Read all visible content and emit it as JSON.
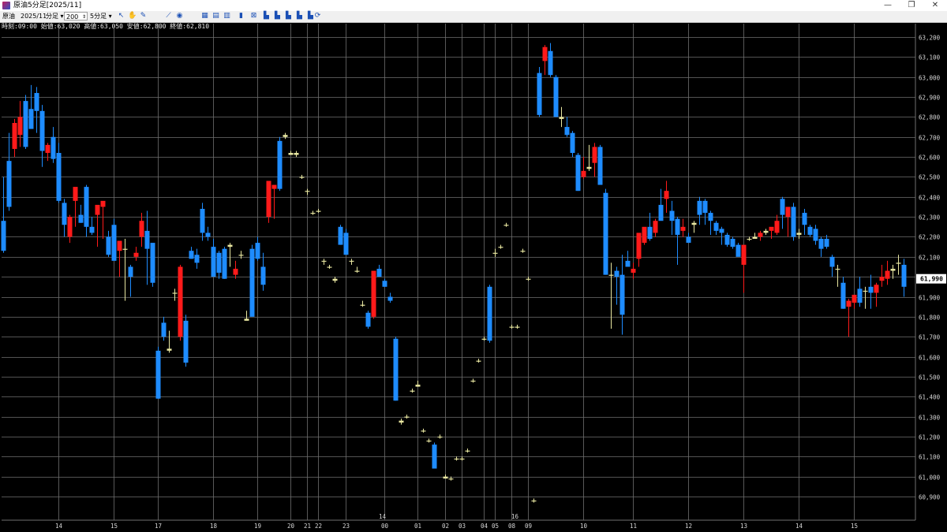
{
  "window": {
    "title": "原油5分足[2025/11]"
  },
  "window_controls": {
    "minimize": "—",
    "restore": "❐",
    "close": "✕"
  },
  "toolbar": {
    "symbol": "原油",
    "contract": "2025/11",
    "period_type": "分足",
    "bar_count": "200",
    "interval": "5分足",
    "icons": [
      "cursor-icon",
      "hand-icon",
      "pencil-icon",
      "line-icon",
      "circle-icon",
      "grid-icon",
      "table-icon",
      "table2-icon",
      "bar-chart-icon",
      "indicator-icon",
      "chart1-icon",
      "chart2-icon",
      "chart3-icon",
      "chart4-icon",
      "chart5-icon",
      "refresh-icon"
    ]
  },
  "quote_line": "時刻:09:00 始値:63,020 高値:63,050 安値:62,800 終値:62,810",
  "colors": {
    "up": "#ff1a1a",
    "down": "#1e8cff",
    "doji": "#e8e6a0",
    "grid": "#6f6f6f",
    "axis_text": "#d8d8d8"
  },
  "chart_data": {
    "type": "candlestick",
    "ylim": [
      60850,
      63250
    ],
    "y_ticks": [
      "63,200",
      "63,100",
      "63,000",
      "62,900",
      "62,800",
      "62,700",
      "62,600",
      "62,500",
      "62,400",
      "62,300",
      "62,200",
      "62,100",
      "62,000",
      "61,900",
      "61,800",
      "61,700",
      "61,600",
      "61,500",
      "61,400",
      "61,300",
      "61,200",
      "61,100",
      "61,000",
      "60,900"
    ],
    "y_tick_values": [
      63200,
      63100,
      63000,
      62900,
      62800,
      62700,
      62600,
      62500,
      62400,
      62300,
      62200,
      62100,
      62000,
      61900,
      61800,
      61700,
      61600,
      61500,
      61400,
      61300,
      61200,
      61100,
      61000,
      60900
    ],
    "last_price": "61,990",
    "last_price_value": 61990,
    "x_labels": [
      "14",
      "15",
      "17",
      "18",
      "19",
      "20",
      "21",
      "22",
      "23",
      "00",
      "01",
      "02",
      "03",
      "04",
      "05",
      "08",
      "09",
      "10",
      "11",
      "12",
      "13",
      "14",
      "15"
    ],
    "x_label_bar_index": [
      10,
      20,
      28,
      38,
      46,
      52,
      55,
      57,
      62,
      69,
      75,
      80,
      83,
      87,
      89,
      92,
      95,
      105,
      114,
      124,
      134,
      144,
      154
    ],
    "date_labels": [
      "14",
      "16"
    ],
    "date_label_bar_index": [
      68,
      92
    ],
    "bar_x_start": 4,
    "bar_spacing": 7,
    "ohlc": [
      [
        62280,
        62500,
        62120,
        62130
      ],
      [
        62580,
        62720,
        62330,
        62350
      ],
      [
        62640,
        62790,
        62600,
        62770
      ],
      [
        62710,
        62880,
        62650,
        62800
      ],
      [
        62880,
        62910,
        62640,
        62650
      ],
      [
        62840,
        62960,
        62770,
        62740
      ],
      [
        62920,
        62950,
        62720,
        62830
      ],
      [
        62830,
        62860,
        62550,
        62630
      ],
      [
        62620,
        62670,
        62580,
        62660
      ],
      [
        62700,
        62750,
        62570,
        62590
      ],
      [
        62620,
        62670,
        62370,
        62380
      ],
      [
        62370,
        62390,
        62200,
        62260
      ],
      [
        62200,
        62310,
        62170,
        62300
      ],
      [
        62380,
        62390,
        62250,
        62450
      ],
      [
        62310,
        62360,
        62270,
        62270
      ],
      [
        62450,
        62460,
        62200,
        62250
      ],
      [
        62250,
        62300,
        62210,
        62220
      ],
      [
        62310,
        62320,
        62150,
        62360
      ],
      [
        62350,
        62370,
        62190,
        62380
      ],
      [
        62200,
        62230,
        62100,
        62110
      ],
      [
        62260,
        62290,
        62120,
        62080
      ],
      [
        62130,
        62140,
        62000,
        62180
      ],
      [
        62140,
        62190,
        61880,
        62140
      ],
      [
        62050,
        62060,
        61900,
        62000
      ],
      [
        62100,
        62150,
        62080,
        62120
      ],
      [
        62200,
        62320,
        62150,
        62280
      ],
      [
        62230,
        62330,
        61960,
        62140
      ],
      [
        62170,
        61980,
        61950,
        61970
      ],
      [
        61630,
        61650,
        61390,
        61390
      ],
      [
        61770,
        61800,
        61680,
        61700
      ],
      [
        61640,
        61730,
        61620,
        61630
      ],
      [
        61920,
        61940,
        61880,
        61920
      ],
      [
        61700,
        62060,
        61680,
        62050
      ],
      [
        61780,
        61810,
        61550,
        61570
      ],
      [
        62130,
        62150,
        62090,
        62090
      ],
      [
        62110,
        62140,
        62040,
        62070
      ],
      [
        62340,
        62370,
        62180,
        62220
      ],
      [
        62220,
        62250,
        62180,
        62200
      ],
      [
        62150,
        62190,
        62050,
        62000
      ],
      [
        62120,
        62130,
        61990,
        62020
      ],
      [
        62140,
        62150,
        61990,
        61990
      ],
      [
        62160,
        62170,
        62050,
        62150
      ],
      [
        62010,
        62080,
        61990,
        62040
      ],
      [
        62110,
        62130,
        62090,
        62110
      ],
      [
        61790,
        61830,
        61780,
        61780
      ],
      [
        62140,
        62160,
        62050,
        61800
      ],
      [
        62170,
        62200,
        62080,
        62090
      ],
      [
        62050,
        62120,
        61930,
        61960
      ],
      [
        62300,
        62470,
        62270,
        62480
      ],
      [
        62440,
        62450,
        62290,
        62460
      ],
      [
        62680,
        62700,
        62430,
        62440
      ],
      [
        62710,
        62720,
        62690,
        62700
      ],
      [
        62620,
        62630,
        62610,
        62610
      ],
      [
        62620,
        62630,
        62600,
        62610
      ],
      [
        62500,
        62510,
        62490,
        62500
      ],
      [
        62430,
        62440,
        62410,
        62430
      ],
      [
        62320,
        62330,
        62310,
        62320
      ],
      [
        62330,
        62340,
        62320,
        62330
      ],
      [
        62080,
        62090,
        62060,
        62080
      ],
      [
        62050,
        62060,
        62040,
        62050
      ],
      [
        61980,
        62000,
        61970,
        61990
      ],
      [
        62250,
        62260,
        62160,
        62160
      ],
      [
        62220,
        62240,
        62110,
        62110
      ],
      [
        62080,
        62090,
        62060,
        62080
      ],
      [
        62030,
        62050,
        62020,
        62030
      ],
      [
        61860,
        61880,
        61850,
        61860
      ],
      [
        61820,
        61830,
        61740,
        61750
      ],
      [
        61800,
        61860,
        61790,
        62030
      ],
      [
        62040,
        62060,
        62010,
        62000
      ],
      [
        61980,
        61990,
        61950,
        61950
      ],
      [
        61900,
        61920,
        61870,
        61880
      ],
      [
        61690,
        61700,
        61380,
        61380
      ],
      [
        61280,
        61290,
        61260,
        61270
      ],
      [
        61300,
        61310,
        61290,
        61300
      ],
      [
        61430,
        61440,
        61420,
        61430
      ],
      [
        61460,
        61480,
        61450,
        61450
      ],
      [
        61230,
        61240,
        61220,
        61230
      ],
      [
        61180,
        61190,
        61170,
        61180
      ],
      [
        61160,
        61170,
        61040,
        61040
      ],
      [
        61200,
        61210,
        61190,
        61200
      ],
      [
        61000,
        61010,
        60990,
        60990
      ],
      [
        60990,
        61000,
        60980,
        60990
      ],
      [
        61090,
        61100,
        61080,
        61090
      ],
      [
        61090,
        61100,
        61080,
        61090
      ],
      [
        61130,
        61140,
        61120,
        61130
      ],
      [
        61480,
        61490,
        61470,
        61480
      ],
      [
        61580,
        61590,
        61570,
        61580
      ],
      [
        61690,
        61700,
        61680,
        61690
      ],
      [
        61950,
        61960,
        61670,
        61680
      ],
      [
        62120,
        62140,
        62100,
        62120
      ],
      [
        62150,
        62160,
        62140,
        62150
      ],
      [
        62260,
        62270,
        62250,
        62260
      ],
      [
        61750,
        61760,
        61740,
        61750
      ],
      [
        61750,
        61760,
        61740,
        61750
      ],
      [
        62130,
        62140,
        62120,
        62130
      ],
      [
        61990,
        62000,
        61980,
        61990
      ],
      [
        60880,
        60890,
        60870,
        60880
      ],
      [
        63020,
        63050,
        62800,
        62810
      ],
      [
        63080,
        63160,
        63010,
        63150
      ],
      [
        63130,
        63170,
        63000,
        63010
      ],
      [
        63000,
        63010,
        62800,
        62800
      ],
      [
        62800,
        62850,
        62750,
        62790
      ],
      [
        62750,
        62800,
        62700,
        62710
      ],
      [
        62720,
        62730,
        62600,
        62620
      ],
      [
        62610,
        62620,
        62430,
        62430
      ],
      [
        62500,
        62600,
        62490,
        62530
      ],
      [
        62550,
        62660,
        62530,
        62540
      ],
      [
        62570,
        62670,
        62500,
        62650
      ],
      [
        62650,
        62660,
        62470,
        62460
      ],
      [
        62420,
        62440,
        62010,
        62010
      ],
      [
        62010,
        62070,
        61740,
        62010
      ],
      [
        62030,
        62050,
        61860,
        62000
      ],
      [
        62010,
        62110,
        61710,
        61810
      ],
      [
        62080,
        62130,
        62060,
        62050
      ],
      [
        62020,
        62070,
        61990,
        62040
      ],
      [
        62090,
        62180,
        62050,
        62220
      ],
      [
        62170,
        62240,
        62160,
        62250
      ],
      [
        62250,
        62320,
        62180,
        62190
      ],
      [
        62220,
        62290,
        62200,
        62280
      ],
      [
        62360,
        62440,
        62320,
        62280
      ],
      [
        62390,
        62480,
        62320,
        62430
      ],
      [
        62330,
        62380,
        62210,
        62280
      ],
      [
        62290,
        62300,
        62060,
        62210
      ],
      [
        62230,
        62290,
        62200,
        62250
      ],
      [
        62200,
        62220,
        62170,
        62170
      ],
      [
        62260,
        62280,
        62220,
        62270
      ],
      [
        62380,
        62400,
        62260,
        62310
      ],
      [
        62380,
        62390,
        62260,
        62320
      ],
      [
        62320,
        62330,
        62210,
        62280
      ],
      [
        62270,
        62280,
        62210,
        62230
      ],
      [
        62240,
        62250,
        62160,
        62220
      ],
      [
        62210,
        62220,
        62150,
        62160
      ],
      [
        62190,
        62200,
        62140,
        62150
      ],
      [
        62160,
        62170,
        62110,
        62100
      ],
      [
        62060,
        62070,
        61920,
        62160
      ],
      [
        62190,
        62200,
        62180,
        62190
      ],
      [
        62200,
        62220,
        62190,
        62190
      ],
      [
        62200,
        62230,
        62180,
        62220
      ],
      [
        62230,
        62240,
        62210,
        62220
      ],
      [
        62230,
        62240,
        62190,
        62250
      ],
      [
        62220,
        62310,
        62210,
        62280
      ],
      [
        62390,
        62400,
        62240,
        62310
      ],
      [
        62300,
        62340,
        62200,
        62350
      ],
      [
        62350,
        62370,
        62180,
        62200
      ],
      [
        62220,
        62240,
        62190,
        62210
      ],
      [
        62320,
        62340,
        62210,
        62260
      ],
      [
        62250,
        62260,
        62200,
        62210
      ],
      [
        62240,
        62260,
        62160,
        62180
      ],
      [
        62190,
        62200,
        62100,
        62140
      ],
      [
        62190,
        62210,
        62140,
        62150
      ],
      [
        62100,
        62110,
        62000,
        62050
      ],
      [
        62040,
        62060,
        61950,
        62040
      ],
      [
        61970,
        62000,
        61840,
        61840
      ],
      [
        61850,
        61890,
        61700,
        61880
      ],
      [
        61870,
        61900,
        61840,
        61910
      ],
      [
        61940,
        62000,
        61850,
        61870
      ],
      [
        61930,
        61950,
        61840,
        61930
      ],
      [
        61950,
        62010,
        61840,
        61920
      ],
      [
        61920,
        61970,
        61850,
        61960
      ],
      [
        61980,
        62060,
        61950,
        62000
      ],
      [
        61990,
        62080,
        61960,
        62030
      ],
      [
        62040,
        62060,
        61990,
        62030
      ],
      [
        62070,
        62110,
        62010,
        62070
      ],
      [
        62060,
        62090,
        61900,
        61950
      ]
    ]
  }
}
